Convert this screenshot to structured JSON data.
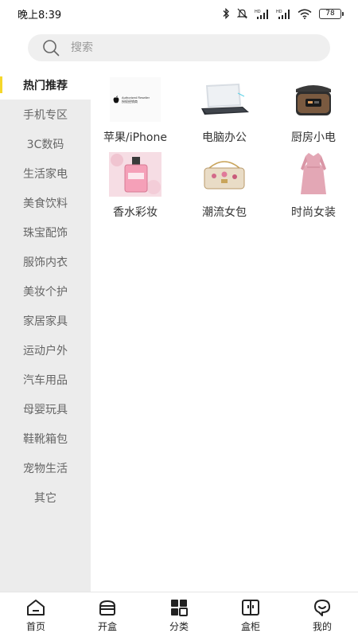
{
  "status_bar": {
    "time": "晚上8:39",
    "network_label_1": "HD",
    "network_label_2": "HD",
    "battery": "78"
  },
  "search": {
    "placeholder": "搜索"
  },
  "sidebar": {
    "items": [
      {
        "label": "热门推荐",
        "active": true
      },
      {
        "label": "手机专区"
      },
      {
        "label": "3C数码"
      },
      {
        "label": "生活家电"
      },
      {
        "label": "美食饮料"
      },
      {
        "label": "珠宝配饰"
      },
      {
        "label": "服饰内衣"
      },
      {
        "label": "美妆个护"
      },
      {
        "label": "家居家具"
      },
      {
        "label": "运动户外"
      },
      {
        "label": "汽车用品"
      },
      {
        "label": "母婴玩具"
      },
      {
        "label": "鞋靴箱包"
      },
      {
        "label": "宠物生活"
      },
      {
        "label": "其它"
      }
    ],
    "accent_color": "#f5d72b"
  },
  "categories": [
    {
      "label": "苹果/iPhone",
      "image": "apple-reseller-image",
      "badge_text_1": "Authorized Reseller",
      "badge_text_2": "授权经销商"
    },
    {
      "label": "电脑办公",
      "image": "laptop-image"
    },
    {
      "label": "厨房小电",
      "image": "rice-cooker-image"
    },
    {
      "label": "香水彩妆",
      "image": "perfume-image"
    },
    {
      "label": "潮流女包",
      "image": "handbag-image"
    },
    {
      "label": "时尚女装",
      "image": "dress-image"
    }
  ],
  "tab_bar": {
    "tabs": [
      {
        "label": "首页",
        "icon": "home-icon"
      },
      {
        "label": "开盒",
        "icon": "box-open-icon"
      },
      {
        "label": "分类",
        "icon": "category-icon"
      },
      {
        "label": "盒柜",
        "icon": "cabinet-icon"
      },
      {
        "label": "我的",
        "icon": "profile-icon"
      }
    ]
  }
}
